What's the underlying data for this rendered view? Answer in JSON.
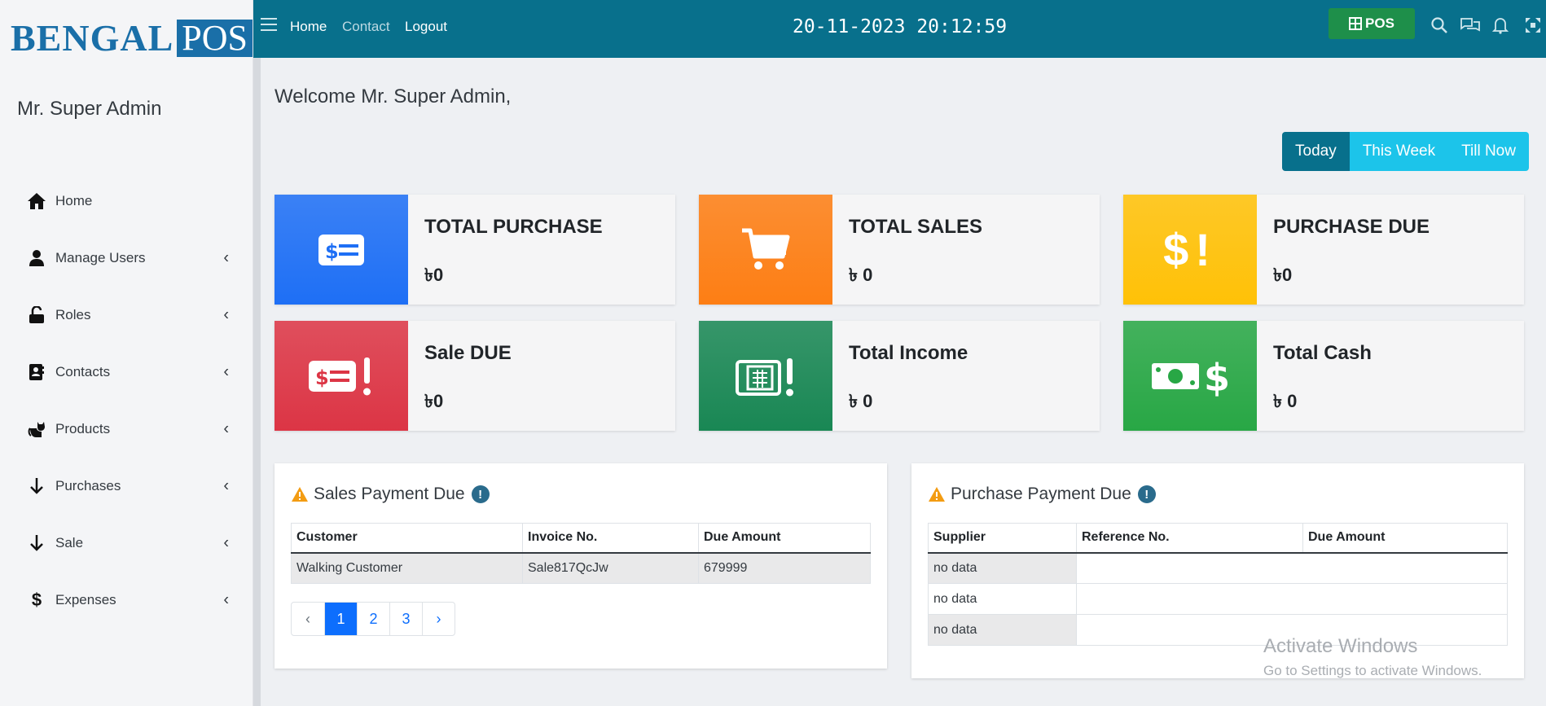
{
  "brand": {
    "part1": "BENGAL",
    "part2": "POS"
  },
  "user": {
    "name": "Mr. Super Admin"
  },
  "sidebar": {
    "items": [
      {
        "label": "Home",
        "icon": "home-icon",
        "has_submenu": false
      },
      {
        "label": "Manage Users",
        "icon": "user-icon",
        "has_submenu": true
      },
      {
        "label": "Roles",
        "icon": "lock-open-icon",
        "has_submenu": true
      },
      {
        "label": "Contacts",
        "icon": "address-book-icon",
        "has_submenu": true
      },
      {
        "label": "Products",
        "icon": "cat-icon",
        "has_submenu": true
      },
      {
        "label": "Purchases",
        "icon": "arrow-down-icon",
        "has_submenu": true
      },
      {
        "label": "Sale",
        "icon": "arrow-down-icon",
        "has_submenu": true
      },
      {
        "label": "Expenses",
        "icon": "dollar-icon",
        "has_submenu": true
      }
    ]
  },
  "topbar": {
    "links": {
      "home": "Home",
      "contact": "Contact",
      "logout": "Logout"
    },
    "clock": "20-11-2023 20:12:59",
    "pos_label": "POS",
    "icons": [
      "search-icon",
      "chat-icon",
      "bell-icon",
      "expand-icon"
    ]
  },
  "main": {
    "welcome": "Welcome Mr. Super Admin,",
    "period": {
      "today": "Today",
      "week": "This Week",
      "all": "Till Now",
      "selected": "Today"
    },
    "cards": [
      {
        "title": "TOTAL PURCHASE",
        "value": "৳0",
        "color": "#1e6ff5"
      },
      {
        "title": "TOTAL SALES",
        "value": "৳ 0",
        "color": "#fd7e14"
      },
      {
        "title": "PURCHASE DUE",
        "value": "৳0",
        "color": "#ffc107"
      },
      {
        "title": "Sale DUE",
        "value": "৳0",
        "color": "#dc3545"
      },
      {
        "title": "Total Income",
        "value": "৳ 0",
        "color": "#198754"
      },
      {
        "title": "Total Cash",
        "value": "৳ 0",
        "color": "#28a745"
      }
    ],
    "sales_due": {
      "title": "Sales Payment Due",
      "headers": [
        "Customer",
        "Invoice No.",
        "Due Amount"
      ],
      "rows": [
        [
          "Walking Customer",
          "Sale817QcJw",
          "679999"
        ]
      ],
      "pager": {
        "prev": "‹",
        "pages": [
          "1",
          "2",
          "3"
        ],
        "next": "›",
        "current": "1"
      }
    },
    "purchase_due": {
      "title": "Purchase Payment Due",
      "headers": [
        "Supplier",
        "Reference No.",
        "Due Amount"
      ],
      "rows": [
        [
          "no data",
          "",
          ""
        ],
        [
          "no data",
          "",
          ""
        ],
        [
          "no data",
          "",
          ""
        ]
      ]
    }
  },
  "watermark": {
    "line1": "Activate Windows",
    "line2": "Go to Settings to activate Windows."
  }
}
